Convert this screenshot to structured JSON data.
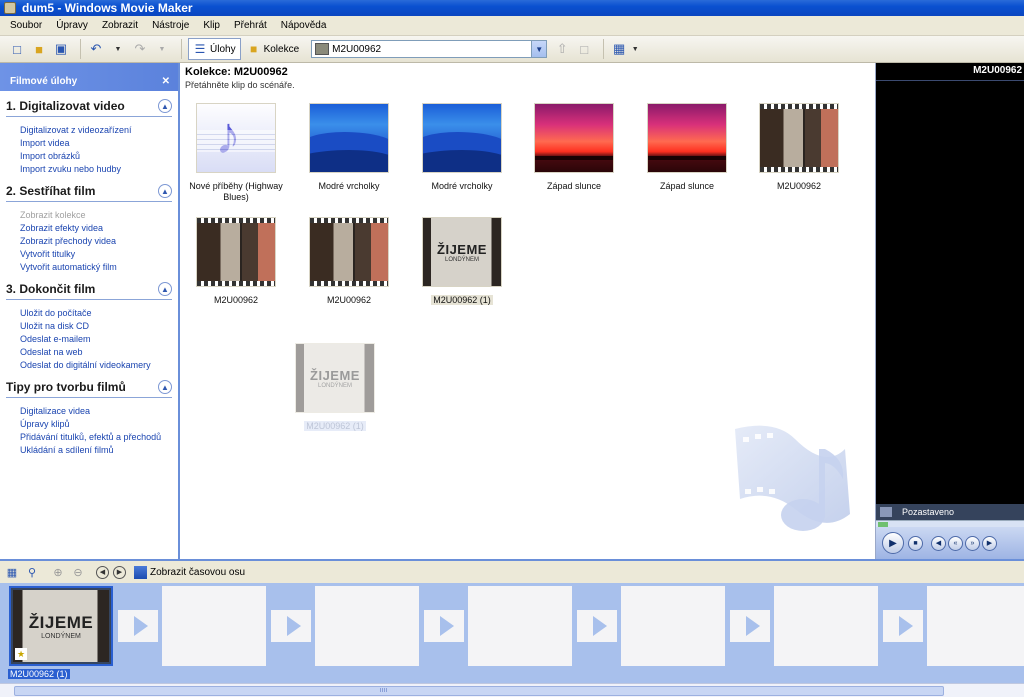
{
  "window": {
    "title": "dum5 - Windows Movie Maker"
  },
  "menu": [
    "Soubor",
    "Úpravy",
    "Zobrazit",
    "Nástroje",
    "Klip",
    "Přehrát",
    "Nápověda"
  ],
  "toolbar": {
    "tasks_label": "Úlohy",
    "collections_label": "Kolekce",
    "collection_value": "M2U00962"
  },
  "taskpane": {
    "header": "Filmové úlohy",
    "sections": [
      {
        "title": "1. Digitalizovat video",
        "links": [
          "Digitalizovat z videozařízení",
          "Import videa",
          "Import obrázků",
          "Import zvuku nebo hudby"
        ]
      },
      {
        "title": "2. Sestříhat film",
        "links": [
          "Zobrazit kolekce",
          "Zobrazit efekty videa",
          "Zobrazit přechody videa",
          "Vytvořit titulky",
          "Vytvořit automatický film"
        ]
      },
      {
        "title": "3. Dokončit film",
        "links": [
          "Uložit do počítače",
          "Uložit na disk CD",
          "Odeslat e-mailem",
          "Odeslat na web",
          "Odeslat do digitální videokamery"
        ]
      },
      {
        "title": "Tipy pro tvorbu filmů",
        "links": [
          "Digitalizace videa",
          "Úpravy klipů",
          "Přidávání titulků, efektů a přechodů",
          "Ukládání a sdílení filmů"
        ]
      }
    ]
  },
  "collection": {
    "title": "Kolekce: M2U00962",
    "hint": "Přetáhněte klip do scénáře.",
    "clips": [
      {
        "label": "Nové příběhy (Highway Blues)",
        "kind": "note-icon"
      },
      {
        "label": "Modré vrcholky",
        "kind": "mountains"
      },
      {
        "label": "Modré vrcholky",
        "kind": "mountains"
      },
      {
        "label": "Západ slunce",
        "kind": "sunset"
      },
      {
        "label": "Západ slunce",
        "kind": "sunset"
      },
      {
        "label": "M2U00962",
        "kind": "photo"
      },
      {
        "label": "M2U00962",
        "kind": "photo"
      },
      {
        "label": "M2U00962",
        "kind": "photo"
      },
      {
        "label": "M2U00962 (1)",
        "kind": "sign"
      },
      {
        "label": "M2U00962 (1)",
        "kind": "sign"
      }
    ],
    "sign_text_big": "ŽIJEME",
    "sign_text_small": "LONDÝNEM"
  },
  "monitor": {
    "title": "M2U00962",
    "status": "Pozastaveno"
  },
  "storyboard": {
    "toggle_label": "Zobrazit časovou osu",
    "first_clip_caption": "M2U00962 (1)"
  },
  "colors": {
    "accent": "#2a5fd0",
    "link": "#1b45b0",
    "storyboard_bg": "#a8c0ec"
  }
}
